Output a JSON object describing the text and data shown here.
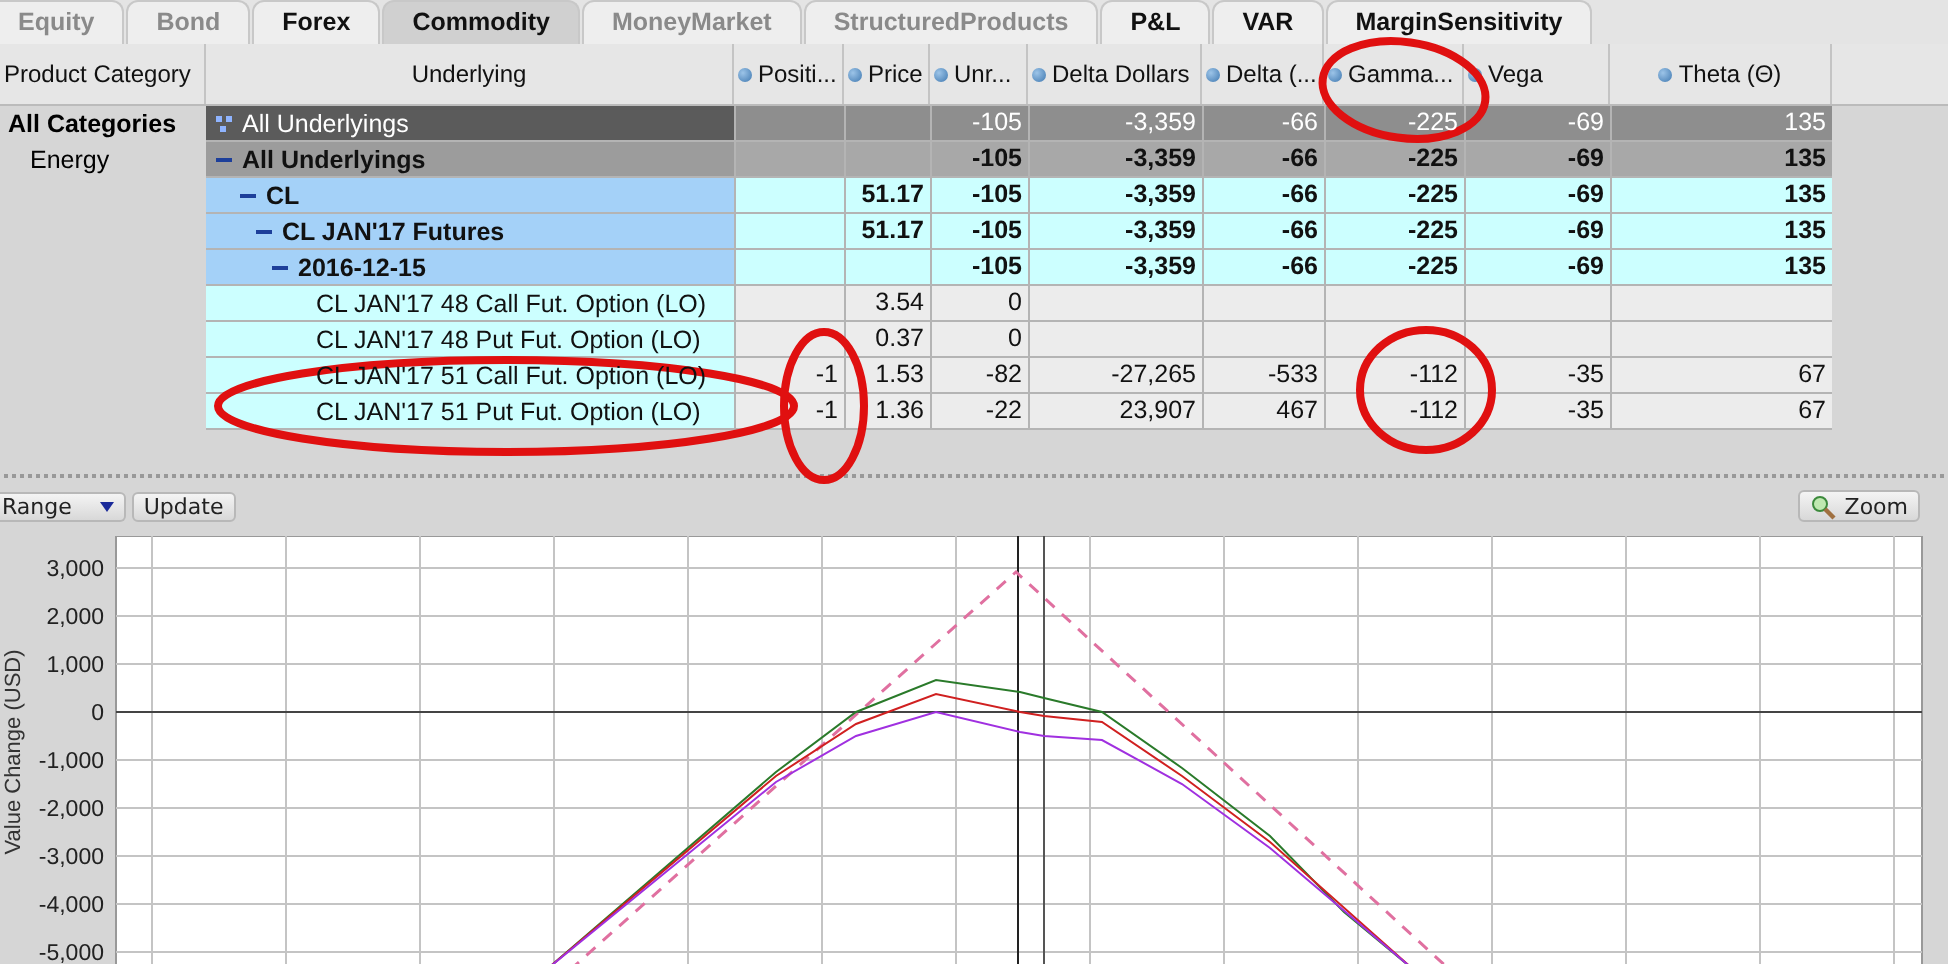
{
  "tabs": [
    {
      "label": "Equity",
      "selected": false,
      "disabled": true
    },
    {
      "label": "Bond",
      "selected": false,
      "disabled": true
    },
    {
      "label": "Forex",
      "selected": false,
      "disabled": false
    },
    {
      "label": "Commodity",
      "selected": true,
      "disabled": false
    },
    {
      "label": "MoneyMarket",
      "selected": false,
      "disabled": true
    },
    {
      "label": "StructuredProducts",
      "selected": false,
      "disabled": true
    },
    {
      "label": "P&L",
      "selected": false,
      "disabled": false
    },
    {
      "label": "VAR",
      "selected": false,
      "disabled": false
    },
    {
      "label": "MarginSensitivity",
      "selected": false,
      "disabled": false
    }
  ],
  "table": {
    "columns": [
      {
        "label": "Product Category",
        "dot": false
      },
      {
        "label": "Underlying",
        "dot": false
      },
      {
        "label": "Positi...",
        "dot": true
      },
      {
        "label": "Price",
        "dot": true
      },
      {
        "label": "Unr...",
        "dot": true
      },
      {
        "label": "Delta Dollars",
        "dot": true
      },
      {
        "label": "Delta (...",
        "dot": true
      },
      {
        "label": "Gamma...",
        "dot": true
      },
      {
        "label": "Vega",
        "dot": true
      },
      {
        "label": "Theta (Θ)",
        "dot": true
      }
    ],
    "categories": [
      {
        "label": "All Categories",
        "kind": "all"
      },
      {
        "label": "Energy",
        "kind": "sector"
      }
    ],
    "rows": [
      {
        "kind": "summary",
        "name": "All Underlyings",
        "unr": "-105",
        "delta_dollars": "-3,359",
        "delta": "-66",
        "gamma": "-225",
        "vega": "-69",
        "theta": "135"
      },
      {
        "kind": "total",
        "name": "All Underlyings",
        "expanded": true,
        "unr": "-105",
        "delta_dollars": "-3,359",
        "delta": "-66",
        "gamma": "-225",
        "vega": "-69",
        "theta": "135",
        "children": [
          {
            "kind": "group",
            "name": "CL",
            "expanded": true,
            "price": "51.17",
            "unr": "-105",
            "delta_dollars": "-3,359",
            "delta": "-66",
            "gamma": "-225",
            "vega": "-69",
            "theta": "135",
            "children": [
              {
                "kind": "group",
                "name": "CL JAN'17 Futures",
                "expanded": true,
                "price": "51.17",
                "unr": "-105",
                "delta_dollars": "-3,359",
                "delta": "-66",
                "gamma": "-225",
                "vega": "-69",
                "theta": "135",
                "children": [
                  {
                    "kind": "group",
                    "name": "2016-12-15",
                    "expanded": true,
                    "unr": "-105",
                    "delta_dollars": "-3,359",
                    "delta": "-66",
                    "gamma": "-225",
                    "vega": "-69",
                    "theta": "135",
                    "children": [
                      {
                        "kind": "leaf",
                        "name": "CL JAN'17 48 Call Fut. Option (LO)",
                        "price": "3.54",
                        "unr": "0"
                      },
                      {
                        "kind": "leaf",
                        "name": "CL JAN'17 48 Put Fut. Option (LO)",
                        "price": "0.37",
                        "unr": "0"
                      },
                      {
                        "kind": "leaf",
                        "name": "CL JAN'17 51 Call Fut. Option (LO)",
                        "positi": "-1",
                        "price": "1.53",
                        "unr": "-82",
                        "delta_dollars": "-27,265",
                        "delta": "-533",
                        "gamma": "-112",
                        "vega": "-35",
                        "theta": "67"
                      },
                      {
                        "kind": "leaf",
                        "name": "CL JAN'17 51 Put Fut. Option (LO)",
                        "positi": "-1",
                        "price": "1.36",
                        "unr": "-22",
                        "delta_dollars": "23,907",
                        "delta": "467",
                        "gamma": "-112",
                        "vega": "-35",
                        "theta": "67"
                      }
                    ]
                  }
                ]
              }
            ]
          }
        ]
      }
    ]
  },
  "chart_toolbar": {
    "range": "Range",
    "update": "Update",
    "zoom": "Zoom"
  },
  "chart": {
    "ylabel": "Value Change (USD)",
    "ytick_labels": [
      "3,000",
      "2,000",
      "1,000",
      "0",
      "-1,000",
      "-2,000",
      "-3,000",
      "-4,000",
      "-5,000"
    ]
  }
}
